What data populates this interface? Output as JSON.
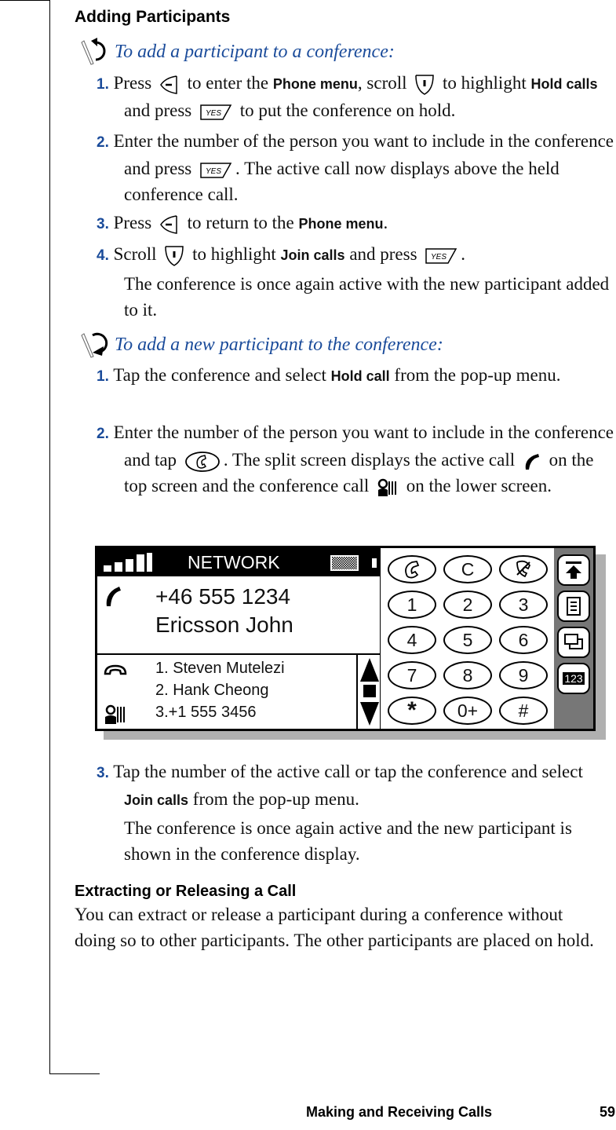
{
  "section1": {
    "heading": "Adding Participants",
    "procedure1": {
      "title": "To add a participant to a conference:",
      "steps": [
        {
          "num": "1.",
          "t1": "Press",
          "t2": "to enter the",
          "b1": "Phone menu",
          "t3": ", scroll",
          "t4": "to highlight",
          "b2": "Hold calls",
          "t5": "and press",
          "t6": "to put the conference on hold."
        },
        {
          "num": "2.",
          "text": "Enter the number of the person you want to include in the conference and press",
          "text2": ". The active call now displays above the held conference call."
        },
        {
          "num": "3.",
          "t1": "Press",
          "t2": "to return to the",
          "b1": "Phone menu",
          "t3": "."
        },
        {
          "num": "4.",
          "t1": "Scroll",
          "t2": "to highlight",
          "b1": "Join calls",
          "t3": "and press",
          "t4": "."
        }
      ],
      "note": "The conference is once again active with the new participant added to it."
    },
    "procedure2": {
      "title": "To add a new participant to the conference:",
      "steps": [
        {
          "num": "1.",
          "t1": "Tap the conference and select",
          "b1": "Hold call",
          "t2": "from the pop-up menu."
        },
        {
          "num": "2.",
          "t1": "Enter the number of the person you want to include in the conference and tap",
          "t2": ". The split screen displays the active call",
          "t3": "on the top screen and the conference call",
          "t4": "on the lower screen."
        },
        {
          "num": "3.",
          "t1": "Tap the number of the active call or tap the conference and select",
          "b1": "Join calls",
          "t2": "from the pop-up menu."
        }
      ],
      "note": "The conference is once again active and the new participant is shown in the conference display."
    }
  },
  "phone_screen": {
    "network": "NETWORK",
    "active_call": {
      "number": "+46 555 1234",
      "name": "Ericsson John"
    },
    "conference": [
      "1. Steven Mutelezi",
      "2. Hank Cheong",
      "3.+1 555 3456"
    ],
    "keys": [
      "C",
      "1",
      "2",
      "3",
      "4",
      "5",
      "6",
      "7",
      "8",
      "9",
      "*",
      "0+",
      "#"
    ],
    "side_label": "123"
  },
  "section2": {
    "heading": "Extracting or Releasing a Call",
    "body": "You can extract or release a participant during a conference without doing so to other participants. The other participants are placed on hold."
  },
  "footer": {
    "chapter": "Making and Receiving Calls",
    "page": "59"
  }
}
